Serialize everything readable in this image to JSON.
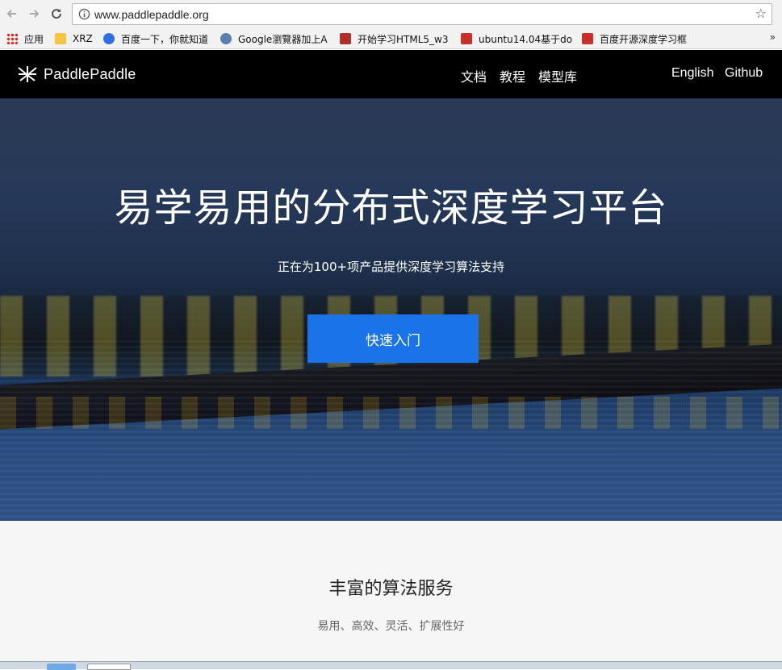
{
  "browser": {
    "url": "www.paddlepaddle.org",
    "bookmarks": [
      {
        "label": "应用",
        "icon": "apps-grid-icon",
        "color": "#d93025"
      },
      {
        "label": "XRZ",
        "icon": "folder-icon",
        "color": "#f4c542"
      },
      {
        "label": "百度一下，你就知道",
        "icon": "baidu-paw-icon",
        "color": "#2f6fe0"
      },
      {
        "label": "Google瀏覽器加上A",
        "icon": "bird-icon",
        "color": "#5a7fb0"
      },
      {
        "label": "开始学习HTML5_w3",
        "icon": "w3c-icon",
        "color": "#b3302a"
      },
      {
        "label": "ubuntu14.04基于do",
        "icon": "csdn-icon",
        "color": "#c9302c"
      },
      {
        "label": "百度开源深度学习框",
        "icon": "csdn-icon",
        "color": "#c9302c"
      }
    ],
    "more_label": "»"
  },
  "header": {
    "logo_text": "PaddlePaddle",
    "nav": [
      "文档",
      "教程",
      "模型库"
    ],
    "right_links": [
      "English",
      "Github"
    ]
  },
  "hero": {
    "title": "易学易用的分布式深度学习平台",
    "subtitle": "正在为100+项产品提供深度学习算法支持",
    "cta_label": "快速入门",
    "cta_color": "#1a73e8"
  },
  "services": {
    "title": "丰富的算法服务",
    "subtitle": "易用、高效、灵活、扩展性好"
  }
}
